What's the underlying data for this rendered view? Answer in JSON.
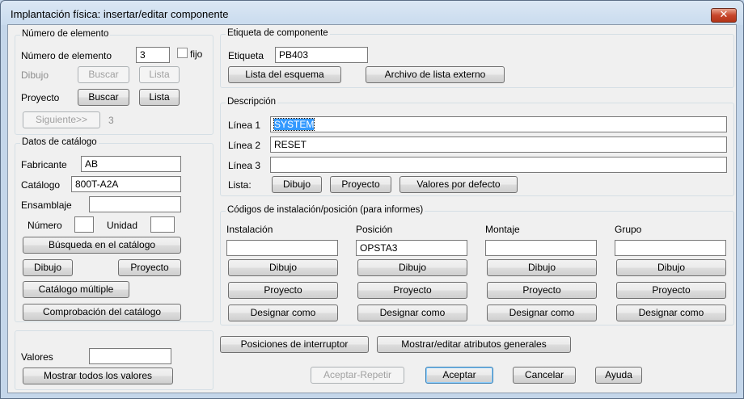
{
  "window": {
    "title": "Implantación física: insertar/editar componente",
    "close_glyph": "✕"
  },
  "element_number": {
    "group_title": "Número de elemento",
    "number_label": "Número de elemento",
    "number_value": "3",
    "fixed_label": "fijo",
    "drawing_label": "Dibujo",
    "drawing_search": "Buscar",
    "drawing_list": "Lista",
    "project_label": "Proyecto",
    "project_search": "Buscar",
    "project_list": "Lista",
    "next_button": "Siguiente>>",
    "next_value": "3"
  },
  "catalog": {
    "group_title": "Datos de catálogo",
    "manufacturer_label": "Fabricante",
    "manufacturer_value": "AB",
    "catalog_label": "Catálogo",
    "catalog_value": "800T-A2A",
    "assembly_label": "Ensamblaje",
    "assembly_value": "",
    "number_label": "Número",
    "number_value": "",
    "unit_label": "Unidad",
    "unit_value": "",
    "lookup_button": "Búsqueda en el catálogo",
    "drawing_button": "Dibujo",
    "project_button": "Proyecto",
    "multiple_button": "Catálogo múltiple",
    "check_button": "Comprobación del catálogo"
  },
  "values": {
    "label": "Valores",
    "value": "",
    "show_all_button": "Mostrar todos los valores"
  },
  "tag": {
    "group_title": "Etiqueta de componente",
    "label": "Etiqueta",
    "value": "PB403",
    "schematic_list_button": "Lista del esquema",
    "external_list_button": "Archivo de lista externo"
  },
  "description": {
    "group_title": "Descripción",
    "line1_label": "Línea 1",
    "line1_value": "SYSTEM",
    "line2_label": "Línea 2",
    "line2_value": "RESET",
    "line3_label": "Línea 3",
    "line3_value": "",
    "list_label": "Lista:",
    "drawing_button": "Dibujo",
    "project_button": "Proyecto",
    "defaults_button": "Valores por defecto"
  },
  "codes": {
    "group_title": "Códigos de instalación/posición (para informes)",
    "columns": [
      {
        "label": "Instalación",
        "value": "",
        "drawing": "Dibujo",
        "project": "Proyecto",
        "designate": "Designar como"
      },
      {
        "label": "Posición",
        "value": "OPSTA3",
        "drawing": "Dibujo",
        "project": "Proyecto",
        "designate": "Designar como"
      },
      {
        "label": "Montaje",
        "value": "",
        "drawing": "Dibujo",
        "project": "Proyecto",
        "designate": "Designar como"
      },
      {
        "label": "Grupo",
        "value": "",
        "drawing": "Dibujo",
        "project": "Proyecto",
        "designate": "Designar como"
      }
    ]
  },
  "bottom": {
    "switch_positions_button": "Posiciones de interruptor",
    "attributes_button": "Mostrar/editar atributos generales",
    "accept_repeat_button": "Aceptar-Repetir",
    "accept_button": "Aceptar",
    "cancel_button": "Cancelar",
    "help_button": "Ayuda"
  }
}
